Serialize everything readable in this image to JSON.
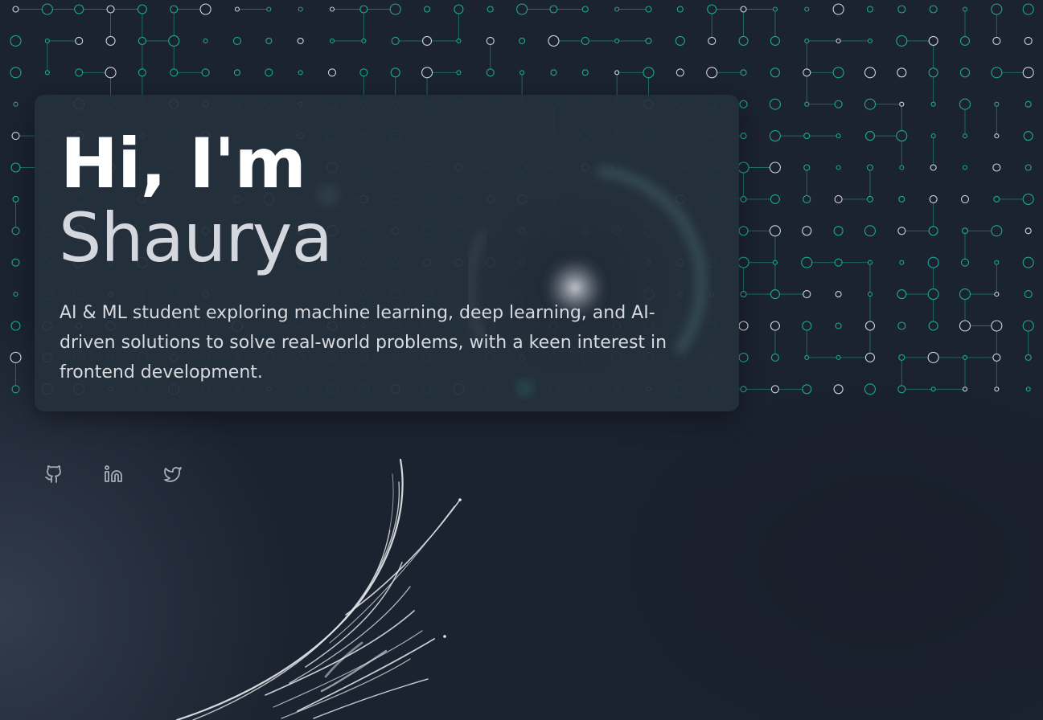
{
  "hero": {
    "greeting": "Hi, I'm",
    "name": "Shaurya",
    "description": "AI & ML student exploring machine learning, deep learning, and AI-driven solutions to solve real-world problems, with a keen interest in frontend development."
  },
  "social": [
    {
      "platform": "GitHub",
      "icon": "github-icon"
    },
    {
      "platform": "LinkedIn",
      "icon": "linkedin-icon"
    },
    {
      "platform": "Twitter",
      "icon": "twitter-icon"
    }
  ],
  "colors": {
    "background": "#1b2230",
    "card": "#24303c",
    "accent_teal": "#1fbfa5",
    "node_white": "#e6e9ee",
    "heading": "#ffffff",
    "name": "#d4d7de",
    "body_text": "#d6d9de",
    "icon": "#a7adb8"
  }
}
